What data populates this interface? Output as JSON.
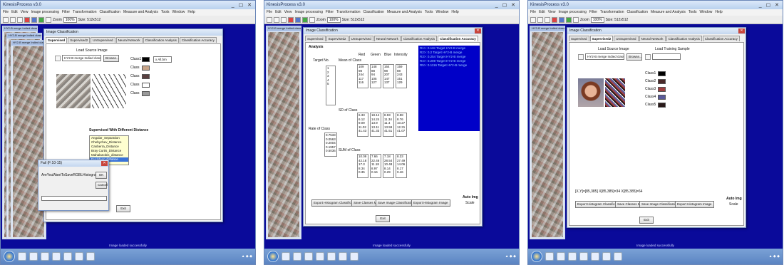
{
  "app": {
    "title": "KinesisProcess v3.0",
    "menu": [
      "File",
      "Edit",
      "View",
      "Image processing",
      "Filter",
      "Transformation",
      "Filter",
      "Classification",
      "Measure and Analysis",
      "Tools",
      "Window",
      "Help"
    ],
    "zoom_label": "Zoom",
    "zoom_value": "100%",
    "size_label": "Size: 512x512",
    "status": "Image loaded successfully"
  },
  "shots": [
    {
      "image_window_title": "HY2-B merge Indied class All.bm",
      "dialog_title": "Image Classification",
      "tabs": [
        "Supervised",
        "Supervised2",
        "UnSupervised",
        "Neural Network",
        "Classification Analysis",
        "Classification Accuracy"
      ],
      "load_label": "Load Source Image",
      "source_field": "HY2-B merge Indied class All.bm",
      "browse_label": "Browse...",
      "class_labels": [
        "Class1",
        "Class",
        "Class",
        "Class",
        "Class"
      ],
      "class_colors": [
        "#000000",
        "#c9a68a",
        "#5a4040",
        "#ffffff",
        "#9a9a9a"
      ],
      "target_label": "x All.bm",
      "distance_title": "Supervised With Different Distance",
      "distance_list": [
        "Angular_Separation",
        "Chebychev_Distance",
        "Canberra_Distance",
        "Bray Curtis_Distance",
        "Mahalanobis_distance",
        "Euclidean distance"
      ],
      "exit_label": "Exit",
      "progress_title": "Fail (F:10-15)",
      "progress_message": "AreYouWantToSaveRGBLHistogram",
      "ok_label": "OK",
      "cancel_label": "Cancel"
    },
    {
      "image_window_title": "HY2-B merge Indied class All.bm",
      "dialog_title": "Image Classification",
      "tabs": [
        "Supervised",
        "Supervised2",
        "UnSupervised",
        "Neural Network",
        "Classification Analysis",
        "Classification Accuracy"
      ],
      "analysis_label": "Analysis",
      "target_label": "Target No.",
      "mean_label": "Mean of Class",
      "sd_label": "SD of Class",
      "rate_label": "Rate of Class",
      "sum_label": "SUM of Class",
      "columns": [
        "Red",
        "Green",
        "Blue",
        "Intensity"
      ],
      "mean_values": [
        [
          "109",
          "98",
          "244",
          "117",
          "116"
        ],
        [
          "148",
          "88",
          "94",
          "105",
          "127"
        ],
        [
          "164",
          "98",
          "207",
          "147",
          "137"
        ],
        [
          "159",
          "88",
          "243",
          "151",
          "129"
        ]
      ],
      "sd_values": [
        [
          "6.33",
          "6.12",
          "9.09",
          "11.02",
          "41.43"
        ],
        [
          "18.14",
          "14.24",
          "13.9",
          "13.11",
          "41.33"
        ],
        [
          "8.93",
          "11.34",
          "11.4",
          "13.59",
          "41.51"
        ],
        [
          "8.98",
          "8.76",
          "10.27",
          "12.31",
          "41.07"
        ]
      ],
      "rate_values": [
        "0.7533",
        "0.0563",
        "0.2004",
        "0.1957",
        "0.5036"
      ],
      "sum_values": [
        [
          "10.09",
          "42.18",
          "17.3",
          "8.34",
          "0.35"
        ],
        [
          "7.66",
          "22.46",
          "11.18",
          "8.97",
          "0.16"
        ],
        [
          "7.18",
          "28.54",
          "10.48",
          "8.14",
          "0.29"
        ],
        [
          "8.33",
          "27.49",
          "14.06",
          "8.17",
          "0.46"
        ]
      ],
      "result_lines": [
        "R1>: 0.118   Target HY2-B merge",
        "R2>: 0.2     Target HY2-B merge",
        "R3>: 0.254   Target HY2-B merge",
        "R4>: 0.289   Target HY2-B merge",
        "R5>: 0.1116  Target HY2-B merge"
      ],
      "buttons": [
        "Export Histogram Classification",
        "Save Classes Map",
        "Save Image Classification",
        "Export Histogram Image"
      ],
      "auto_img_label": "Auto Img",
      "auto_sub_label": "Scale",
      "exit_label": "Exit"
    },
    {
      "image_window_title": "HY2-B merge Indied class All.bm",
      "dialog_title": "Image Classification",
      "tabs": [
        "Supervised",
        "Supervised2",
        "UnSupervised",
        "Neural Network",
        "Classification Analysis",
        "Classification Accuracy"
      ],
      "load_label": "Load Source Image",
      "training_label": "Load Training Sample",
      "source_field": "HY2-B merge Indied class All.bm",
      "browse_label": "Browse...",
      "class_labels": [
        "Class1",
        "Class2",
        "Class3",
        "Class4",
        "Class5"
      ],
      "class_colors": [
        "#000000",
        "#4a2a2a",
        "#a04040",
        "#5a5a9a",
        "#2a1a1a"
      ],
      "coords_line": "[X,Y]=[85,385]   X[85,385]=34   X[85,385]=64",
      "buttons": [
        "Export Histogram Classification",
        "Save Classes Map",
        "Save Image Classification",
        "Export Histogram Image"
      ],
      "auto_img_label": "Auto Img",
      "auto_sub_label": "Scale",
      "exit_label": "Exit"
    }
  ]
}
